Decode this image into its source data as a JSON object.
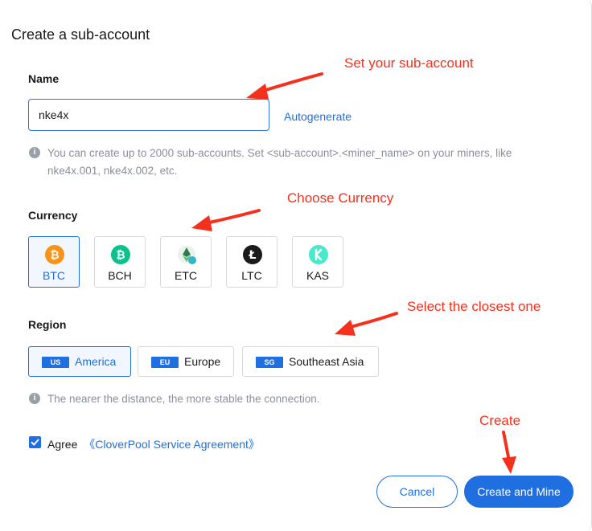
{
  "dialog": {
    "title": "Create a sub-account"
  },
  "name_section": {
    "label": "Name",
    "input_value": "nke4x",
    "autogenerate_label": "Autogenerate",
    "hint_line1": "You can create up to 2000 sub-accounts. Set <sub-account>.<miner_name> on your miners, like",
    "hint_line2": "nke4x.001, nke4x.002, etc."
  },
  "currency_section": {
    "label": "Currency",
    "selected": "BTC",
    "coins": [
      {
        "code": "BTC",
        "icon": "bitcoin-icon",
        "color": "#f7931a"
      },
      {
        "code": "BCH",
        "icon": "bitcoin-cash-icon",
        "color": "#0ac18e"
      },
      {
        "code": "ETC",
        "icon": "ethereum-classic-icon",
        "color": "#3ab83a"
      },
      {
        "code": "LTC",
        "icon": "litecoin-icon",
        "color": "#1a1a1a"
      },
      {
        "code": "KAS",
        "icon": "kaspa-icon",
        "color": "#49eacb"
      }
    ]
  },
  "region_section": {
    "label": "Region",
    "selected": "America",
    "regions": [
      {
        "badge": "US",
        "name": "America"
      },
      {
        "badge": "EU",
        "name": "Europe"
      },
      {
        "badge": "SG",
        "name": "Southeast Asia"
      }
    ],
    "hint": "The nearer the distance, the more stable the connection."
  },
  "agreement": {
    "checked": true,
    "prefix": "Agree",
    "link_text": "《CloverPool Service Agreement》"
  },
  "footer": {
    "cancel_label": "Cancel",
    "create_label": "Create and Mine"
  },
  "annotations": {
    "sub_account": "Set your sub-account",
    "currency": "Choose Currency",
    "region": "Select the closest one",
    "create": "Create",
    "color": "#f5311d"
  },
  "colors": {
    "accent": "#1f6fe0",
    "hint": "#8a8f99"
  }
}
